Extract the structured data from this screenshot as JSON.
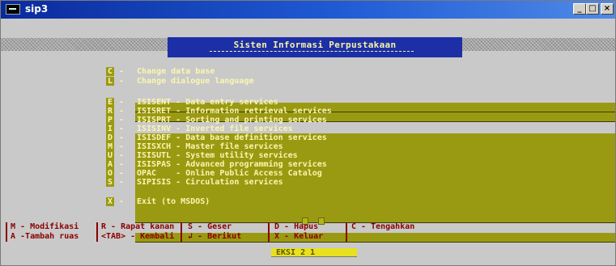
{
  "window": {
    "title": "sip3",
    "buttons": {
      "minimize": "_",
      "maximize": "□",
      "close": "×"
    }
  },
  "banner": {
    "title": "Sisten Informasi Perpustakaan"
  },
  "menu_groups": [
    [
      {
        "key": "C",
        "label": "Change data base"
      },
      {
        "key": "L",
        "label": "Change dialogue language"
      }
    ],
    [
      {
        "key": "E",
        "label": "ISISENT - Data entry services"
      },
      {
        "key": "R",
        "label": "ISISRET - Information retrieval services"
      },
      {
        "key": "P",
        "label": "ISISPRT - Sorting and printing services"
      },
      {
        "key": "I",
        "label": "ISISINV - Inverted file services"
      },
      {
        "key": "D",
        "label": "ISISDEF - Data base definition services"
      },
      {
        "key": "M",
        "label": "ISISXCH - Master file services"
      },
      {
        "key": "U",
        "label": "ISISUTL - System utility services"
      },
      {
        "key": "A",
        "label": "ISISPAS - Advanced programming services"
      },
      {
        "key": "O",
        "label": "OPAC    - Online Public Access Catalog"
      },
      {
        "key": "S",
        "label": "SIPISIS - Circulation services"
      }
    ],
    [
      {
        "key": "X",
        "label": "Exit (to MSDOS)"
      }
    ]
  ],
  "help": {
    "col1": "M - Modifikasi\nA -Tambah ruas",
    "col2": "R - Rapat kanan\n<TAB> - Kembali",
    "col3": "S - Geser\n↲ - Berikut",
    "col4": "D - Hapus\nX - Keluar",
    "col5": "C - Tengahkan"
  },
  "mini_box": {
    "cells": [
      "X",
      ""
    ]
  },
  "status": {
    "text": "EKSI 2  1"
  },
  "colors": {
    "menu_bar": "#9a9a12",
    "menu_text": "#fbf6b0",
    "banner_bg": "#1d2fa6",
    "help_text": "#8b0000",
    "status_bg": "#e8e020"
  }
}
